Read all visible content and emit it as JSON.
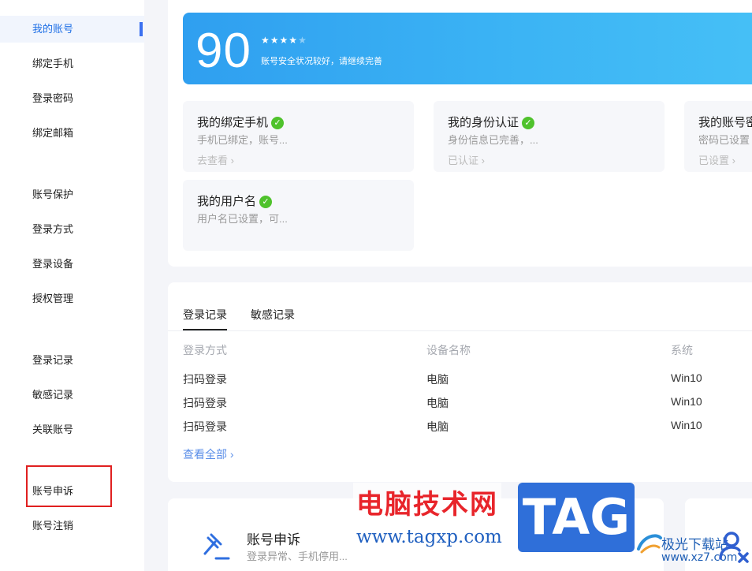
{
  "sidebar": {
    "items": [
      {
        "label": "我的账号",
        "active": true
      },
      {
        "label": "绑定手机"
      },
      {
        "label": "登录密码"
      },
      {
        "label": "绑定邮箱"
      },
      {
        "label": "账号保护"
      },
      {
        "label": "登录方式"
      },
      {
        "label": "登录设备"
      },
      {
        "label": "授权管理"
      },
      {
        "label": "登录记录"
      },
      {
        "label": "敏感记录"
      },
      {
        "label": "关联账号"
      },
      {
        "label": "账号申诉",
        "highlighted": true
      },
      {
        "label": "账号注销"
      }
    ]
  },
  "security": {
    "score": "90",
    "stars_filled": 4,
    "stars_total": 5,
    "message": "账号安全状况较好，请继续完善"
  },
  "status_cards": [
    {
      "title": "我的绑定手机",
      "desc": "手机已绑定，账号...",
      "link": "去查看 ›",
      "icon": "check-circle-icon"
    },
    {
      "title": "我的身份认证",
      "desc": "身份信息已完善，...",
      "link": "已认证 ›",
      "icon": "check-circle-icon"
    },
    {
      "title": "我的账号密码",
      "desc": "密码已设置",
      "link": "已设置 ›",
      "icon": "check-circle-icon"
    },
    {
      "title": "我的用户名",
      "desc": "用户名已设置，可...",
      "link": "",
      "icon": "check-circle-icon"
    }
  ],
  "records": {
    "tabs": [
      {
        "label": "登录记录",
        "active": true
      },
      {
        "label": "敏感记录"
      }
    ],
    "columns": [
      "登录方式",
      "设备名称",
      "系统"
    ],
    "rows": [
      [
        "扫码登录",
        "电脑",
        "Win10"
      ],
      [
        "扫码登录",
        "电脑",
        "Win10"
      ],
      [
        "扫码登录",
        "电脑",
        "Win10"
      ]
    ],
    "view_all": "查看全部 ›"
  },
  "appeal": {
    "title": "账号申诉",
    "desc": "登录异常、手机停用...",
    "icon": "hammer-icon"
  },
  "watermark": {
    "site_name": "电脑技术网",
    "url": "www.tagxp.com",
    "tag": "TAG",
    "jg_name": "极光下载站",
    "jg_url": "www.xz7.com"
  },
  "colors": {
    "accent": "#1e6fe6",
    "banner_start": "#2f9ff0",
    "banner_end": "#46c0f6",
    "check_green": "#4fc22c",
    "highlight_red": "#e02020",
    "watermark_red": "#e8252b",
    "tag_blue": "#2f6fd9"
  }
}
